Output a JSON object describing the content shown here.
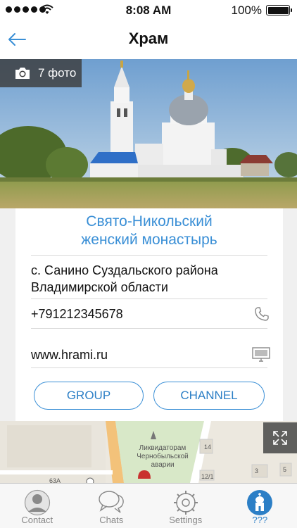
{
  "status": {
    "time": "8:08 AM",
    "battery": "100%"
  },
  "nav": {
    "title": "Храм"
  },
  "photo": {
    "count_label": "7 фото"
  },
  "place": {
    "name_line1": "Свято-Никольский",
    "name_line2": "женский монастырь",
    "address_line1": "с. Санино Суздальского района",
    "address_line2": "Владимирской области",
    "phone": "+791212345678",
    "website": "www.hrami.ru"
  },
  "buttons": {
    "group": "GROUP",
    "channel": "CHANNEL"
  },
  "map": {
    "memorial_line1": "Ликвидаторам",
    "memorial_line2": "Чернобыльской",
    "memorial_line3": "аварии",
    "numbers": [
      "14",
      "3",
      "5",
      "12/1",
      "63А"
    ]
  },
  "tabs": [
    {
      "label": "Contact",
      "icon": "person-icon"
    },
    {
      "label": "Chats",
      "icon": "chat-bubbles-icon"
    },
    {
      "label": "Settings",
      "icon": "gear-icon"
    },
    {
      "label": "???",
      "icon": "church-icon"
    }
  ],
  "colors": {
    "accent": "#3a8fd6",
    "text": "#111111",
    "divider": "#d9d9d9"
  }
}
